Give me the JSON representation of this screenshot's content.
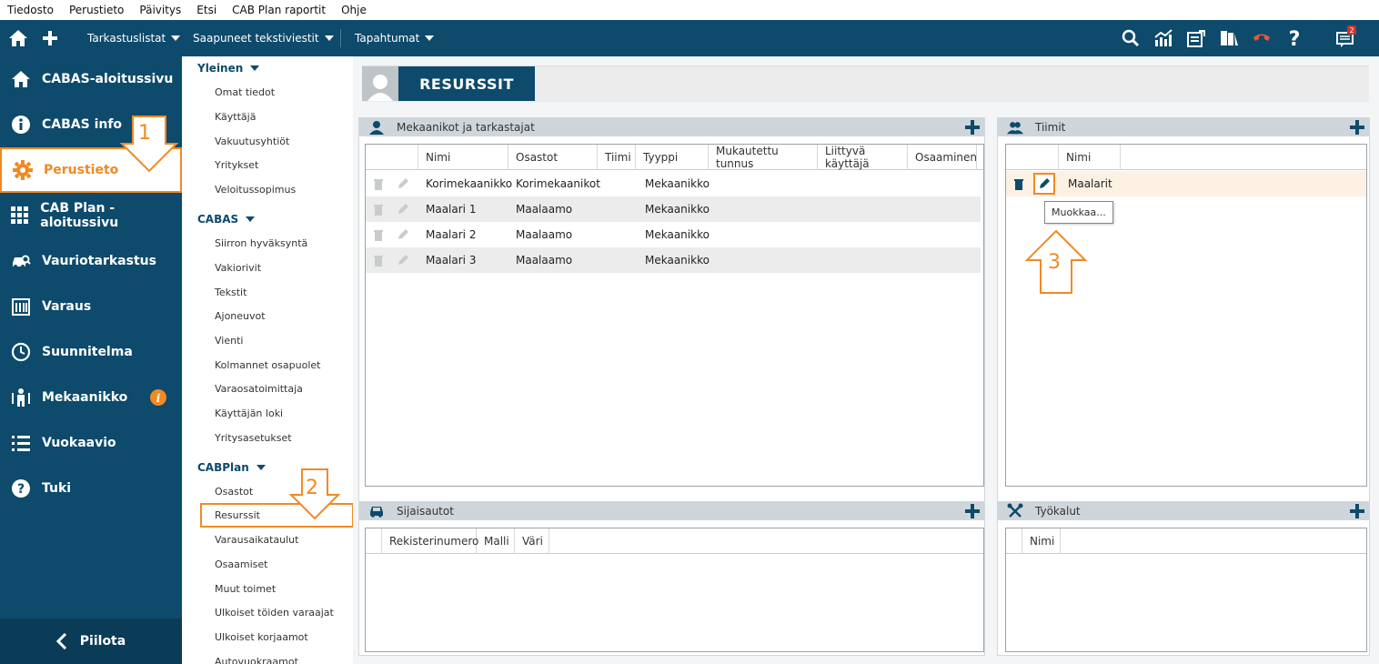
{
  "menubar": [
    "Tiedosto",
    "Perustieto",
    "Päivitys",
    "Etsi",
    "CAB Plan raportit",
    "Ohje"
  ],
  "toolbar": {
    "dropdowns": [
      "Tarkastuslistat",
      "Saapuneet tekstiviestit",
      "Tapahtumat"
    ],
    "notification_count": "2"
  },
  "leftnav": {
    "items": [
      "CABAS-aloitussivu",
      "CABAS info",
      "Perustieto",
      "CAB Plan -aloitussivu",
      "Vauriotarkastus",
      "Varaus",
      "Suunnitelma",
      "Mekaanikko",
      "Vuokaavio",
      "Tuki"
    ],
    "active": "Perustieto",
    "hide_label": "Piilota"
  },
  "subnav": {
    "yleinen": {
      "title": "Yleinen",
      "items": [
        "Omat tiedot",
        "Käyttäjä",
        "Vakuutusyhtiöt",
        "Yritykset",
        "Veloitussopimus"
      ]
    },
    "cabas": {
      "title": "CABAS",
      "items": [
        "Siirron hyväksyntä",
        "Vakiorivit",
        "Tekstit",
        "Ajoneuvot",
        "Vienti",
        "Kolmannet osapuolet",
        "Varaosatoimittaja",
        "Käyttäjän loki",
        "Yritysasetukset"
      ]
    },
    "cabplan": {
      "title": "CABPlan",
      "items": [
        "Osastot",
        "Resurssit",
        "Varausaikataulut",
        "Osaamiset",
        "Muut toimet",
        "Ulkoiset töiden varaajat",
        "Ulkoiset korjaamot",
        "Autovuokraamot"
      ]
    }
  },
  "page": {
    "title": "RESURSSIT"
  },
  "mechanics": {
    "title": "Mekaanikot ja tarkastajat",
    "columns": [
      "Nimi",
      "Osastot",
      "Tiimi",
      "Tyyppi",
      "Mukautettu tunnus",
      "Liittyvä käyttäjä",
      "Osaaminen"
    ],
    "rows": [
      {
        "nimi": "Korimekaanikko",
        "osastot": "Korimekaanikot",
        "tiimi": "",
        "tyyppi": "Mekaanikko"
      },
      {
        "nimi": "Maalari 1",
        "osastot": "Maalaamo",
        "tiimi": "",
        "tyyppi": "Mekaanikko"
      },
      {
        "nimi": "Maalari 2",
        "osastot": "Maalaamo",
        "tiimi": "",
        "tyyppi": "Mekaanikko"
      },
      {
        "nimi": "Maalari 3",
        "osastot": "Maalaamo",
        "tiimi": "",
        "tyyppi": "Mekaanikko"
      }
    ]
  },
  "teams": {
    "title": "Tiimit",
    "columns": [
      "Nimi"
    ],
    "rows": [
      {
        "nimi": "Maalarit"
      }
    ],
    "tooltip": "Muokkaa..."
  },
  "cars": {
    "title": "Sijaisautot",
    "columns": [
      "Rekisterinumero",
      "Malli",
      "Väri"
    ]
  },
  "tools": {
    "title": "Työkalut",
    "columns": [
      "Nimi"
    ]
  },
  "callouts": [
    "1",
    "2",
    "3"
  ],
  "colors": {
    "brand": "#0d4a6c",
    "accent": "#f08a24",
    "header_panel": "#cfd6db"
  }
}
